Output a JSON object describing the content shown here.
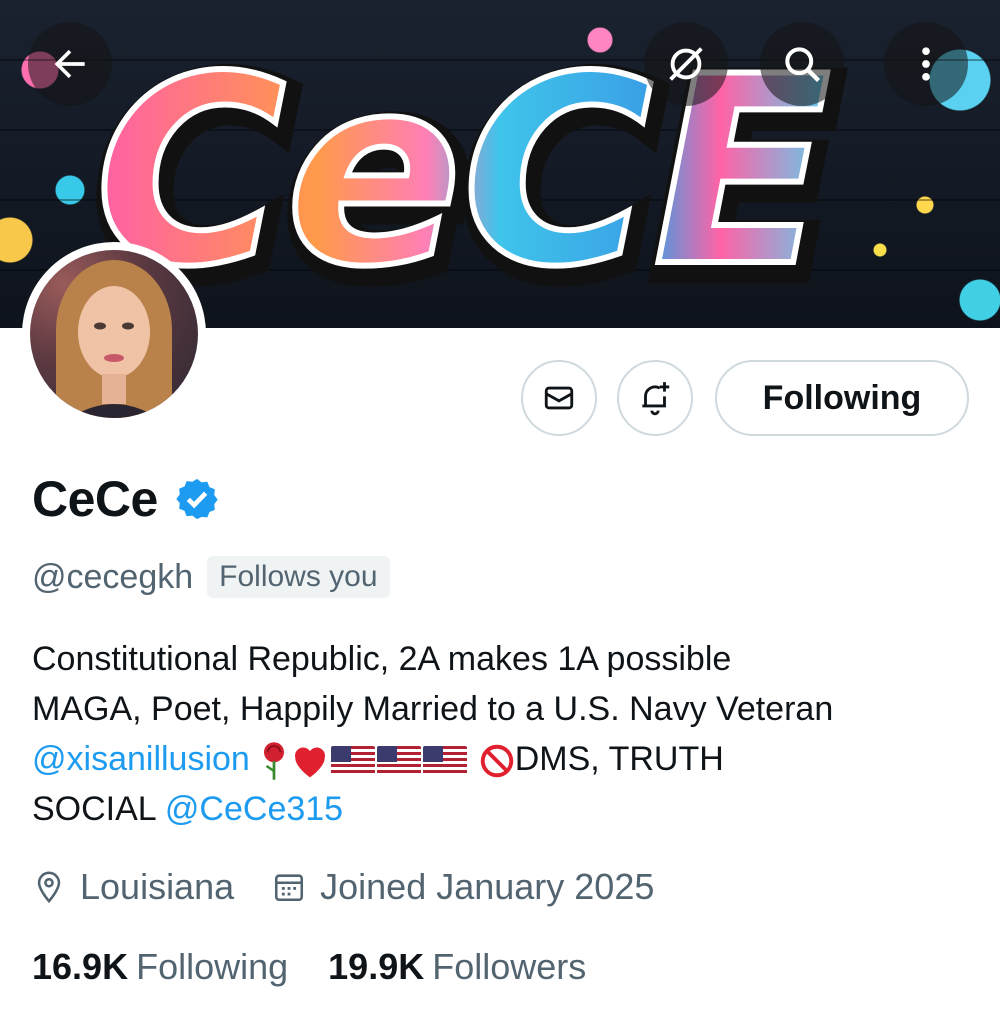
{
  "banner": {
    "art_text": "CeCE"
  },
  "header": {
    "back_icon": "arrow-left-icon",
    "grok_icon": "grok-icon",
    "search_icon": "search-icon",
    "more_icon": "more-vertical-icon"
  },
  "actions": {
    "message_icon": "mail-icon",
    "notify_icon": "bell-plus-icon",
    "follow_label": "Following"
  },
  "profile": {
    "name": "CeCe",
    "handle": "@cecegkh",
    "follows_you": "Follows you",
    "verified_color": "#1d9bf0",
    "bio": {
      "line1": "Constitutional Republic, 2A makes 1A possible",
      "line2": "MAGA, Poet, Happily Married to a U.S. Navy Veteran",
      "mention1": "@xisanillusion",
      "line3_tail": "DMS, TRUTH",
      "line4_text": "SOCIAL",
      "mention2": "@CeCe315"
    },
    "location": "Louisiana",
    "joined": "Joined January 2025"
  },
  "stats": {
    "following_count": "16.9K",
    "following_label": "Following",
    "followers_count": "19.9K",
    "followers_label": "Followers"
  },
  "colors": {
    "link": "#1d9bf0",
    "secondary_text": "#536471",
    "border": "#cfd9de"
  }
}
